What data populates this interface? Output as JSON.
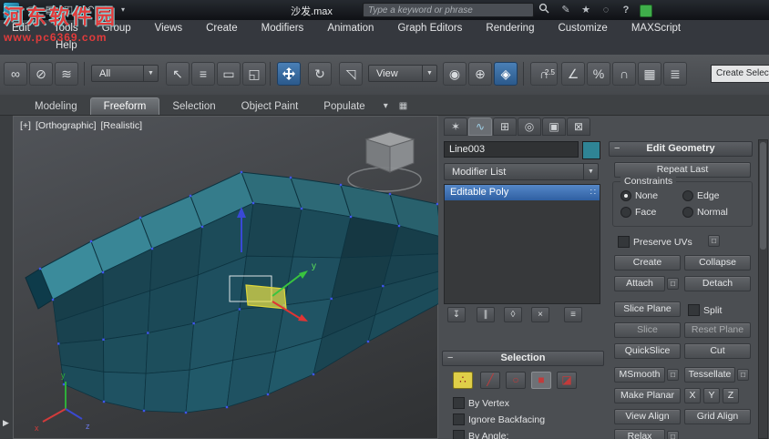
{
  "window": {
    "filename": "沙发.max",
    "search_placeholder": "Type a keyword or phrase"
  },
  "watermark": {
    "line1": "河东软件园",
    "line2": "www.pc6369.com"
  },
  "menubar": {
    "items": [
      "Edit",
      "Tools",
      "Group",
      "Views",
      "Create",
      "Modifiers",
      "Animation",
      "Graph Editors",
      "Rendering",
      "Customize",
      "MAXScript"
    ],
    "help": "Help"
  },
  "toolbar": {
    "selection_filter": "All",
    "coordinate_system": "View",
    "snap_mode": "2.5",
    "named_selection": "Create Selection S"
  },
  "ribbon": {
    "tabs": [
      "Modeling",
      "Freeform",
      "Selection",
      "Object Paint",
      "Populate"
    ],
    "active_tab": "Freeform"
  },
  "viewport": {
    "label_plus": "[+]",
    "label_view": "[Orthographic]",
    "label_shading": "[Realistic]",
    "gizmo_axis_label": "y",
    "tripod": {
      "x": "x",
      "y": "y",
      "z": "z"
    }
  },
  "command_panel": {
    "object_name": "Line003",
    "object_color": "#2f8495",
    "modifier_list": "Modifier List",
    "stack_item": "Editable Poly",
    "selection": {
      "title": "Selection",
      "by_vertex": "By Vertex",
      "ignore_backfacing": "Ignore Backfacing",
      "by_angle": "By Angle:"
    }
  },
  "edit_geometry": {
    "title": "Edit Geometry",
    "repeat_last": "Repeat Last",
    "constraints": "Constraints",
    "none": "None",
    "edge": "Edge",
    "face": "Face",
    "normal": "Normal",
    "preserve_uvs": "Preserve UVs",
    "create": "Create",
    "collapse": "Collapse",
    "attach": "Attach",
    "detach": "Detach",
    "slice_plane": "Slice Plane",
    "split": "Split",
    "slice": "Slice",
    "reset_plane": "Reset Plane",
    "quickslice": "QuickSlice",
    "cut": "Cut",
    "msmooth": "MSmooth",
    "tessellate": "Tessellate",
    "make_planar": "Make Planar",
    "axis_x": "X",
    "axis_y": "Y",
    "axis_z": "Z",
    "view_align": "View Align",
    "grid_align": "Grid Align",
    "relax": "Relax"
  },
  "colors": {
    "active_tool_blue": "#2b598b",
    "stack_selection_blue": "#2f5fa2",
    "mesh_teal_dark": "#134a5c",
    "mesh_teal_light": "#3f93a5",
    "watermark_red": "#e23b3b"
  }
}
